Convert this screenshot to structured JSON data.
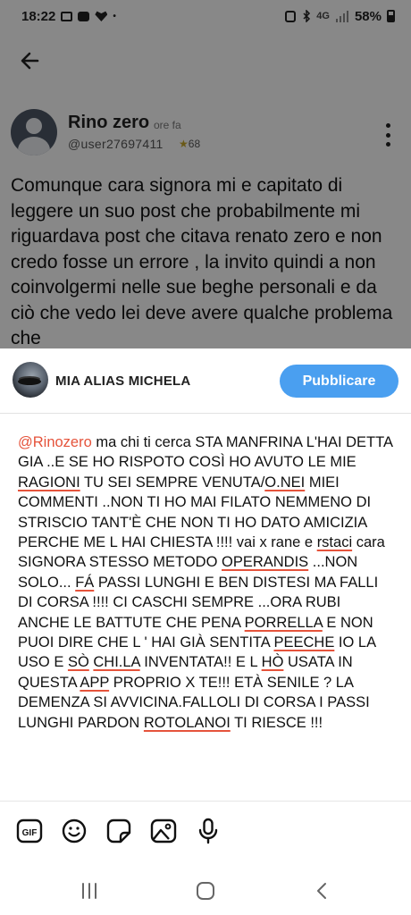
{
  "status_bar": {
    "time": "18:22",
    "dot": "•",
    "network": "4G",
    "battery": "58%"
  },
  "post": {
    "author": "Rino zero",
    "time": "ore fa",
    "handle": "@user27697411",
    "score": "68",
    "body": "Comunque cara signora mi e capitato di leggere un suo post che probabilmente mi riguardava post che citava renato zero e non credo fosse un errore , la invito quindi a non coinvolgermi nelle sue beghe personali e da ciò che vedo lei deve avere qualche problema che"
  },
  "composer": {
    "user": "MIA ALIAS MICHELA",
    "publish_label": "Pubblicare",
    "comment": [
      {
        "t": "@Rinozero",
        "c": "mention"
      },
      {
        "t": " ma chi ti cerca STA MANFRINA L'HAI DETTA GIA ..E SE HO RISPOTO COSÌ HO AVUTO LE MIE "
      },
      {
        "t": "RAGIONI",
        "c": "sp"
      },
      {
        "t": " TU SEI SEMPRE VENUTA/"
      },
      {
        "t": "O.NEI",
        "c": "sp"
      },
      {
        "t": " MIEI COMMENTI ..NON TI HO MAI FILATO NEMMENO DI STRISCIO TANT'È CHE NON   TI HO DATO AMICIZIA PERCHE ME L HAI CHIESTA !!!!  vai x rane e "
      },
      {
        "t": "rstaci",
        "c": "sp"
      },
      {
        "t": " cara SIGNORA STESSO METODO "
      },
      {
        "t": "OPERANDIS",
        "c": "sp"
      },
      {
        "t": "  ...NON SOLO... "
      },
      {
        "t": "FÁ",
        "c": "sp"
      },
      {
        "t": " PASSI LUNGHI E BEN DISTESI MA FALLI  DI CORSA !!!! CI CASCHI SEMPRE ...ORA RUBI ANCHE LE BATTUTE CHE PENA "
      },
      {
        "t": "PORRELLA",
        "c": "sp"
      },
      {
        "t": "   E NON PUOI DIRE CHE L ' HAI GIÀ SENTITA "
      },
      {
        "t": "PEECHE",
        "c": "sp"
      },
      {
        "t": " IO LA USO E "
      },
      {
        "t": "SÒ",
        "c": "sp"
      },
      {
        "t": " "
      },
      {
        "t": "CHI.LA",
        "c": "sp"
      },
      {
        "t": " INVENTATA!! E L "
      },
      {
        "t": "HÒ",
        "c": "sp"
      },
      {
        "t": " USATA IN QUESTA "
      },
      {
        "t": "APP",
        "c": "sp"
      },
      {
        "t": " PROPRIO X TE!!! ETÀ SENILE ? LA DEMENZA SI AVVICINA.FALLOLI DI CORSA I PASSI LUNGHI PARDON "
      },
      {
        "t": "ROTOLANOI",
        "c": "sp"
      },
      {
        "t": " TI RIESCE !!!"
      }
    ]
  },
  "toolbar": {
    "gif_label": "GIF",
    "icons": [
      "gif-icon",
      "emoji-icon",
      "sticker-icon",
      "image-icon",
      "microphone-icon"
    ]
  },
  "navigation": {
    "icons": [
      "recent-apps-icon",
      "home-icon",
      "back-icon"
    ]
  },
  "colors": {
    "accent": "#4a9ff0",
    "mention": "#e5533b",
    "spellcheck_underline": "#e5533b"
  }
}
